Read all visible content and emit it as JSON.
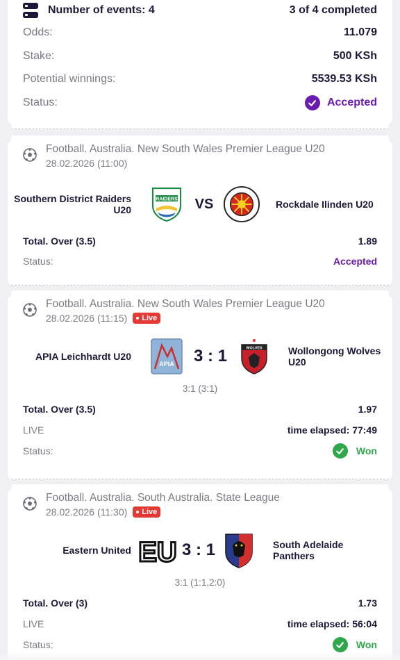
{
  "summary": {
    "events_label": "Number of events: 4",
    "completed": "3 of 4 completed",
    "odds_label": "Odds:",
    "odds_value": "11.079",
    "stake_label": "Stake:",
    "stake_value": "500 KSh",
    "winnings_label": "Potential winnings:",
    "winnings_value": "5539.53 KSh",
    "status_label": "Status:",
    "status_value": "Accepted"
  },
  "events": [
    {
      "league": "Football. Australia. New South Wales Premier League U20",
      "datetime": "28.02.2026 (11:00)",
      "home": "Southern District Raiders U20",
      "away": "Rockdale Ilinden U20",
      "center": "VS",
      "market": "Total. Over (3.5)",
      "odd": "1.89",
      "status_label": "Status:",
      "status": "Accepted"
    },
    {
      "league": "Football. Australia. New South Wales Premier League U20",
      "datetime": "28.02.2026 (11:15)",
      "live_badge": "Live",
      "home": "APIA Leichhardt U20",
      "away": "Wollongong Wolves U20",
      "score": "3 : 1",
      "subscore": "3:1 (3:1)",
      "market": "Total. Over (3.5)",
      "odd": "1.97",
      "live_label": "LIVE",
      "elapsed": "time elapsed: 77:49",
      "status_label": "Status:",
      "status": "Won"
    },
    {
      "league": "Football. Australia. South Australia. State League",
      "datetime": "28.02.2026 (11:30)",
      "live_badge": "Live",
      "home": "Eastern United",
      "away": "South Adelaide Panthers",
      "score": "3 : 1",
      "subscore": "3:1 (1:1,2:0)",
      "market": "Total. Over (3)",
      "odd": "1.73",
      "live_label": "LIVE",
      "elapsed": "time elapsed: 56:04",
      "status_label": "Status:",
      "status": "Won"
    }
  ],
  "logos": {
    "raiders_text": "RAIDERS",
    "wolves_text": "WOLVES",
    "apia_text": "APIA",
    "eu_text": "EU"
  },
  "colors": {
    "accent_purple": "#6a1bb0",
    "won_green": "#2ea84a",
    "live_red": "#e53935",
    "text_dark": "#1e1838",
    "text_muted": "#7a7a86"
  },
  "icons": [
    "events-list-icon",
    "check-circle-icon",
    "football-icon",
    "team-logo"
  ]
}
